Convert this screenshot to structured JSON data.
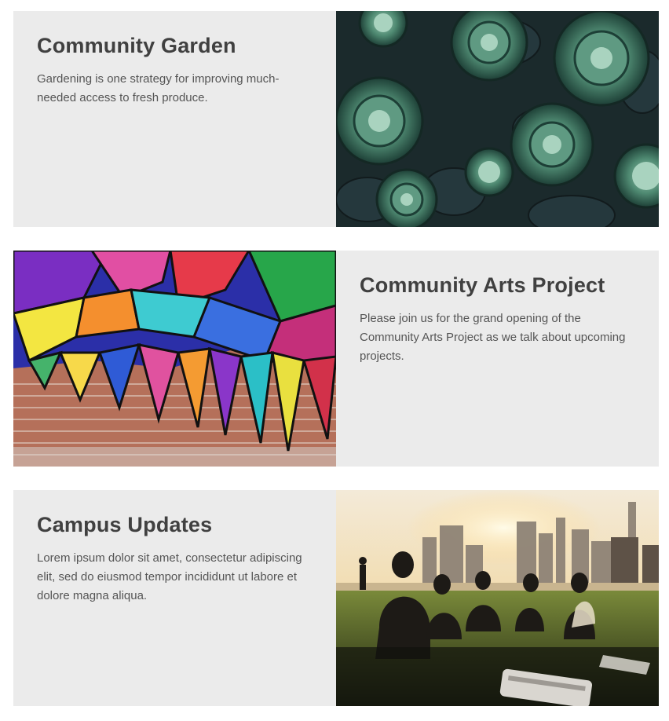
{
  "cards": [
    {
      "title": "Community Garden",
      "body": "Gardening is one strategy for improving much-needed access to fresh produce.",
      "image": "succulents-photo",
      "image_side": "right"
    },
    {
      "title": "Community Arts Project",
      "body": "Please join us for the grand opening of the Community Arts Project as we talk about upcoming projects.",
      "image": "graffiti-mural-photo",
      "image_side": "left"
    },
    {
      "title": "Campus Updates",
      "body": "Lorem ipsum dolor sit amet, consectetur adipiscing elit, sed do eiusmod tempor incididunt ut labore et dolore magna aliqua.",
      "image": "park-picnic-skyline-photo",
      "image_side": "right"
    }
  ],
  "colors": {
    "card_background": "#ebebeb",
    "title": "#404040",
    "body_text": "#555555"
  }
}
